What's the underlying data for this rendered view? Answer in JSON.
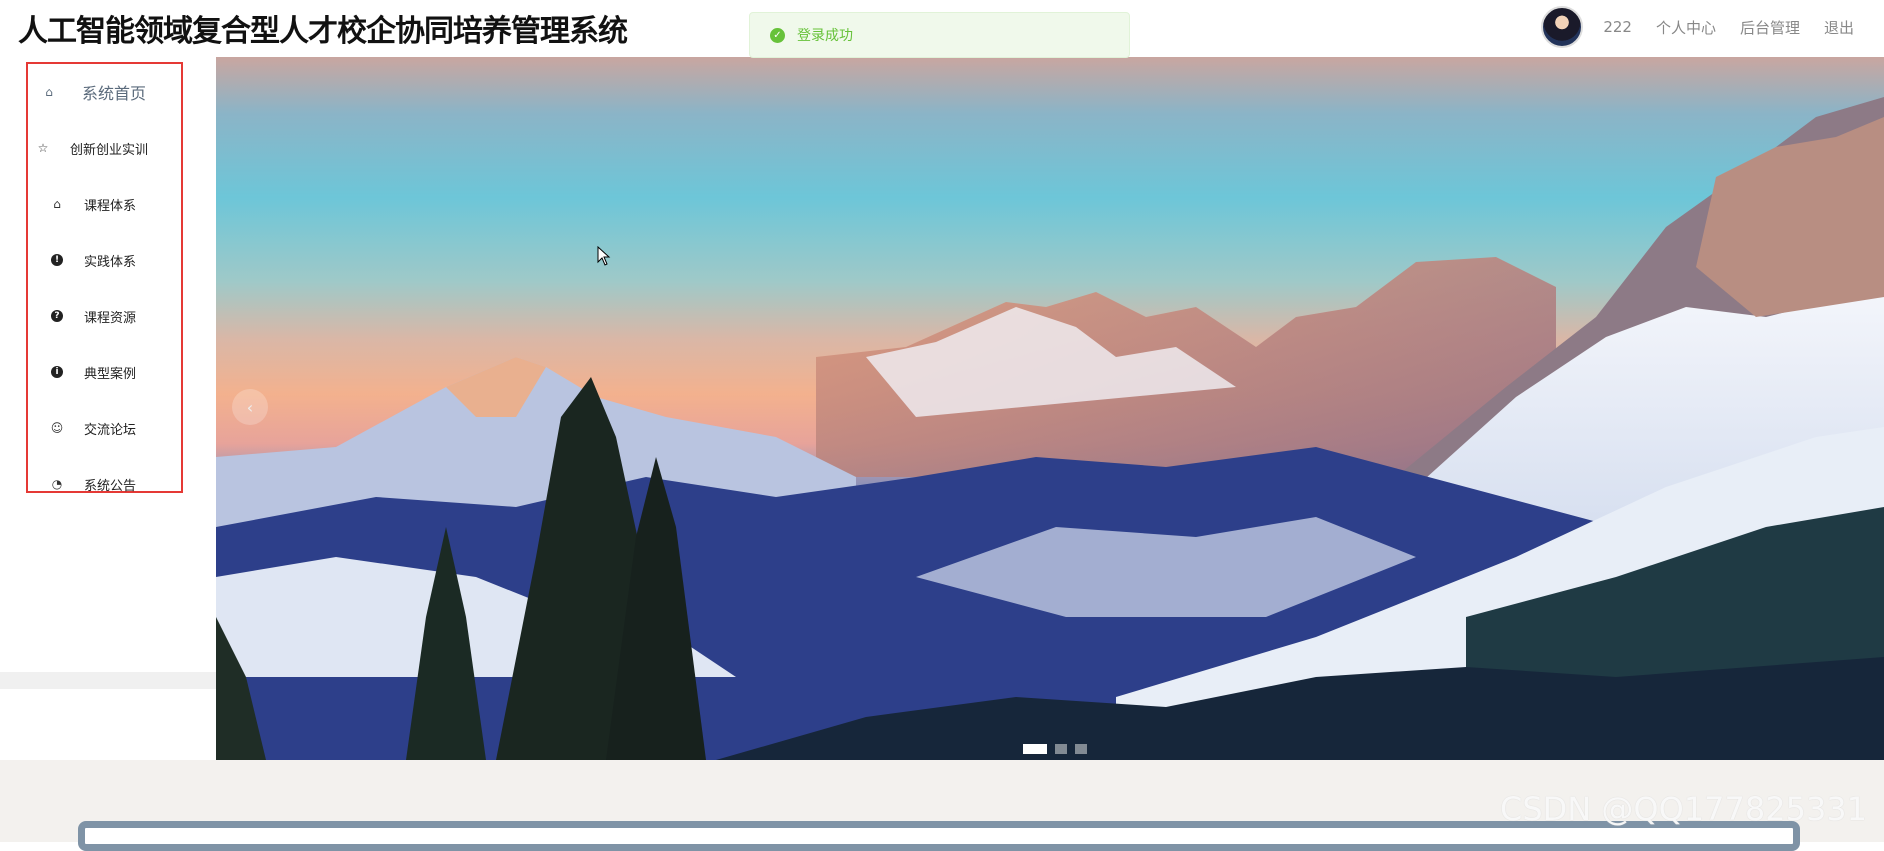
{
  "header": {
    "title": "人工智能领域复合型人才校企协同培养管理系统",
    "username": "222",
    "links": [
      "个人中心",
      "后台管理",
      "退出"
    ]
  },
  "toast": {
    "text": "登录成功",
    "color": "#67c23a"
  },
  "sidebar": {
    "items": [
      {
        "label": "系统首页",
        "icon": "home-icon"
      },
      {
        "label": "创新创业实训",
        "icon": "star-icon"
      },
      {
        "label": "课程体系",
        "icon": "bag-icon"
      },
      {
        "label": "实践体系",
        "icon": "exclamation-circle-icon"
      },
      {
        "label": "课程资源",
        "icon": "question-circle-icon"
      },
      {
        "label": "典型案例",
        "icon": "info-circle-icon"
      },
      {
        "label": "交流论坛",
        "icon": "smile-icon"
      },
      {
        "label": "系统公告",
        "icon": "gauge-icon"
      }
    ],
    "border_color": "#e53935"
  },
  "carousel": {
    "slides": 3,
    "active": 1
  },
  "watermark": "CSDN @QQ177825331"
}
